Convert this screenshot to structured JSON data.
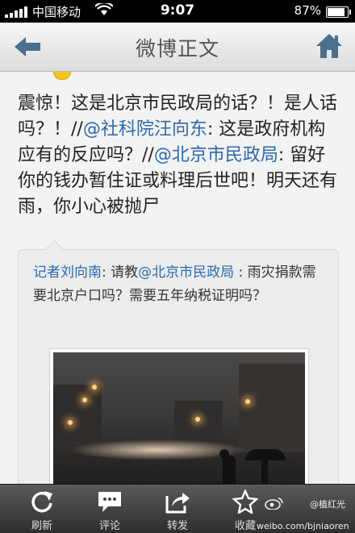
{
  "status_bar": {
    "carrier": "中国移动",
    "time": "9:07",
    "battery": "87%",
    "battery_level": 0.87
  },
  "navbar": {
    "title": "微博正文"
  },
  "post": {
    "seg1": "震惊！这是北京市民政局的话？！是人话吗？！//",
    "mention1": "@社科院汪向东",
    "seg2": ": 这是政府机构应有的反应吗？//",
    "mention2": "@北京市民政局",
    "seg3": ": 留好你的钱办暂住证或料理后世吧！明天还有雨，你小心被抛尸"
  },
  "repost": {
    "author": "记者刘向南",
    "seg1": ": 请教",
    "mention": "@北京市民政局",
    "seg2": " : 雨灾捐款需要北京户口吗？需要五年纳税证明吗？"
  },
  "tabbar": {
    "refresh": "刷新",
    "comment": "评论",
    "forward": "转发",
    "favorite": "收藏"
  },
  "watermark": {
    "user": "@植红光",
    "url": "weibo.com/bjniaoren"
  }
}
